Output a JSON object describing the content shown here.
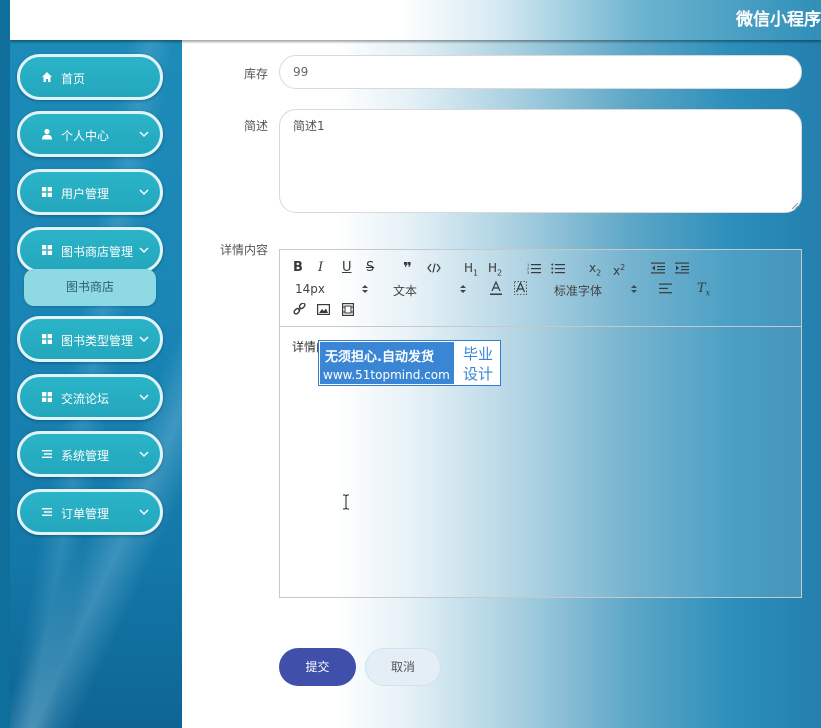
{
  "header": {
    "title": "微信小程序"
  },
  "sidebar": {
    "items": [
      {
        "label": "首页",
        "icon": "home-icon"
      },
      {
        "label": "个人中心",
        "icon": "user-icon"
      },
      {
        "label": "用户管理",
        "icon": "grid-icon"
      },
      {
        "label": "图书商店管理",
        "icon": "grid-icon"
      },
      {
        "label": "图书类型管理",
        "icon": "grid-icon"
      },
      {
        "label": "交流论坛",
        "icon": "grid-icon"
      },
      {
        "label": "系统管理",
        "icon": "list-icon"
      },
      {
        "label": "订单管理",
        "icon": "list-icon"
      }
    ],
    "submenu": {
      "label": "图书商店"
    }
  },
  "form": {
    "stock": {
      "label": "库存",
      "value": "99"
    },
    "desc": {
      "label": "简述",
      "value": "简述1"
    },
    "detail": {
      "label": "详情内容"
    }
  },
  "editor": {
    "font_size": "14px",
    "block_format": "文本",
    "font_family": "标准字体",
    "content": "详情内容1"
  },
  "watermark": {
    "line1": "无须担心.自动发货",
    "line2": "www.51topmind.com",
    "right_line1": "毕业",
    "right_line2": "设计"
  },
  "buttons": {
    "submit": "提交",
    "cancel": "取消"
  },
  "colors": {
    "menu_bg": "#23a7bd",
    "menu_border": "#dff3f8",
    "submenu_bg": "#8fd9e4",
    "submit_bg": "#3f4faa",
    "cancel_bg": "#e4eef6"
  }
}
